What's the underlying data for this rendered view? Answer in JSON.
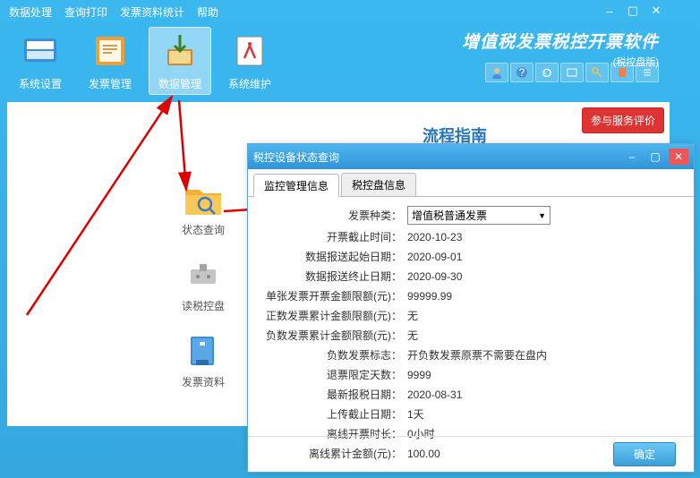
{
  "menu": {
    "m1": "数据处理",
    "m2": "查询打印",
    "m3": "发票资料统计",
    "m4": "帮助"
  },
  "toolbar": {
    "b1": "系统设置",
    "b2": "发票管理",
    "b3": "数据管理",
    "b4": "系统维护"
  },
  "branding": {
    "title": "增值税发票税控开票软件",
    "sub": "(税控盘版)"
  },
  "badge": "参与服务评价",
  "flow_title": "流程指南",
  "side": {
    "s1": "状态查询",
    "s2": "读税控盘",
    "s3": "发票资料"
  },
  "dialog": {
    "title": "税控设备状态查询",
    "tab1": "监控管理信息",
    "tab2": "税控盘信息",
    "rows": [
      {
        "l": "发票种类：",
        "v": "增值税普通发票"
      },
      {
        "l": "开票截止时间：",
        "v": "2020-10-23"
      },
      {
        "l": "数据报送起始日期：",
        "v": "2020-09-01"
      },
      {
        "l": "数据报送终止日期：",
        "v": "2020-09-30"
      },
      {
        "l": "单张发票开票金额限额(元)：",
        "v": "99999.99"
      },
      {
        "l": "正数发票累计金额限额(元)：",
        "v": "无"
      },
      {
        "l": "负数发票累计金额限额(元)：",
        "v": "无"
      },
      {
        "l": "负数发票标志：",
        "v": "开负数发票原票不需要在盘内"
      },
      {
        "l": "退票限定天数：",
        "v": "9999"
      },
      {
        "l": "最新报税日期：",
        "v": "2020-08-31"
      },
      {
        "l": "上传截止日期：",
        "v": "1天"
      },
      {
        "l": "离线开票时长：",
        "v": "0小时"
      },
      {
        "l": "离线累计金额(元)：",
        "v": "100.00"
      }
    ],
    "ok": "确定"
  }
}
